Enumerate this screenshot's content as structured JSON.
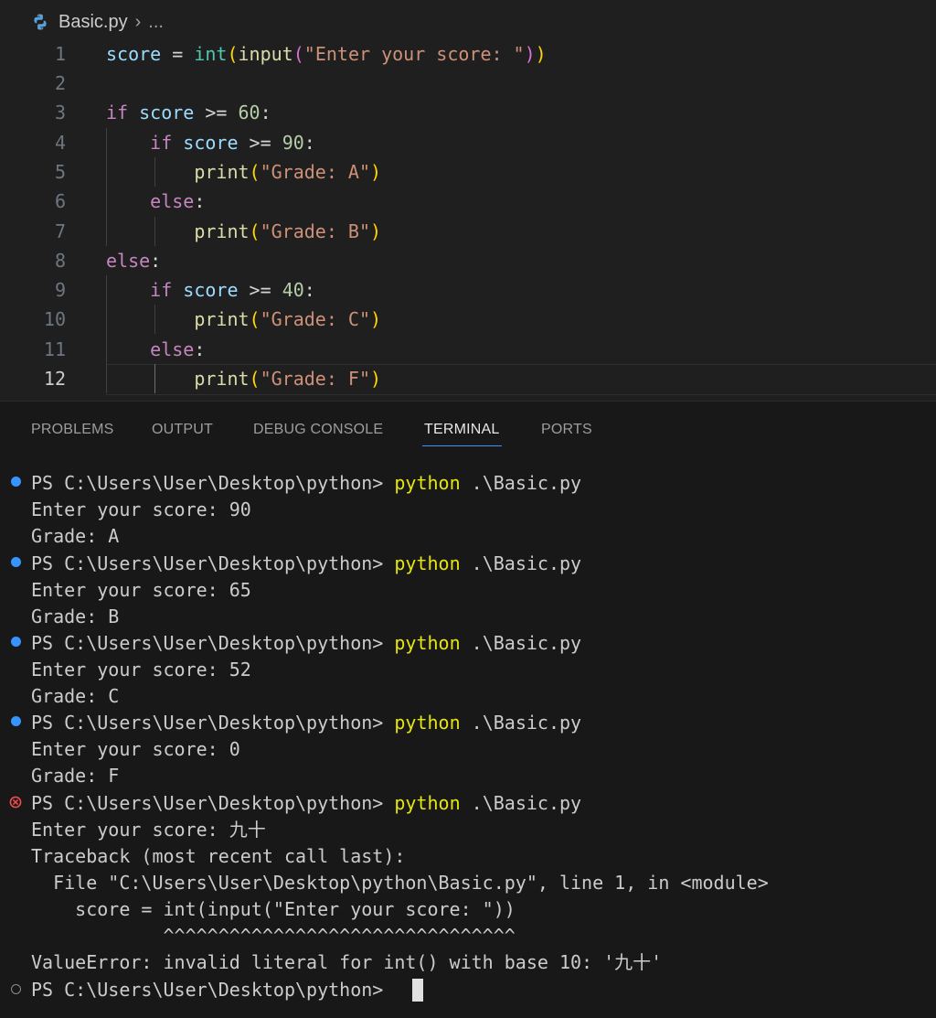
{
  "editor": {
    "breadcrumb": {
      "file": "Basic.py",
      "separator": "›",
      "more": "..."
    },
    "line_numbers": [
      "1",
      "2",
      "3",
      "4",
      "5",
      "6",
      "7",
      "8",
      "9",
      "10",
      "11",
      "12"
    ],
    "active_line": "12",
    "code": {
      "l1": {
        "var": "score",
        "op": " = ",
        "fn": "int",
        "p1o": "(",
        "call": "input",
        "p2o": "(",
        "str": "\"Enter your score: \"",
        "p2c": ")",
        "p1c": ")"
      },
      "l3": {
        "kw": "if",
        "var": " score",
        "op": " >= ",
        "num": "60",
        "colon": ":"
      },
      "l4": {
        "kw": "if",
        "var": " score",
        "op": " >= ",
        "num": "90",
        "colon": ":"
      },
      "l5": {
        "fn": "print",
        "po": "(",
        "str": "\"Grade: A\"",
        "pc": ")"
      },
      "l6": {
        "kw": "else",
        "colon": ":"
      },
      "l7": {
        "fn": "print",
        "po": "(",
        "str": "\"Grade: B\"",
        "pc": ")"
      },
      "l8": {
        "kw": "else",
        "colon": ":"
      },
      "l9": {
        "kw": "if",
        "var": " score",
        "op": " >= ",
        "num": "40",
        "colon": ":"
      },
      "l10": {
        "fn": "print",
        "po": "(",
        "str": "\"Grade: C\"",
        "pc": ")"
      },
      "l11": {
        "kw": "else",
        "colon": ":"
      },
      "l12": {
        "fn": "print",
        "po": "(",
        "str": "\"Grade: F\"",
        "pc": ")"
      }
    }
  },
  "panel": {
    "tabs": [
      "PROBLEMS",
      "OUTPUT",
      "DEBUG CONSOLE",
      "TERMINAL",
      "PORTS"
    ],
    "active_tab": "TERMINAL"
  },
  "terminal": {
    "prompt": "PS C:\\Users\\User\\Desktop\\python> ",
    "command": "python",
    "arg": " .\\Basic.py",
    "runs": [
      {
        "status": "success",
        "input_line": "Enter your score: 90",
        "output": "Grade: A"
      },
      {
        "status": "success",
        "input_line": "Enter your score: 65",
        "output": "Grade: B"
      },
      {
        "status": "success",
        "input_line": "Enter your score: 52",
        "output": "Grade: C"
      },
      {
        "status": "success",
        "input_line": "Enter your score: 0",
        "output": "Grade: F"
      },
      {
        "status": "error",
        "input_line": "Enter your score: 九十"
      }
    ],
    "traceback": [
      "Traceback (most recent call last):",
      "  File \"C:\\Users\\User\\Desktop\\python\\Basic.py\", line 1, in <module>",
      "    score = int(input(\"Enter your score: \"))",
      "            ^^^^^^^^^^^^^^^^^^^^^^^^^^^^^^^^",
      "ValueError: invalid literal for int() with base 10: '九十'"
    ],
    "final_prompt": "PS C:\\Users\\User\\Desktop\\python>",
    "colors": {
      "success_dot": "#3794ff",
      "error_dot": "#f14c4c",
      "command": "#e5e510"
    }
  }
}
